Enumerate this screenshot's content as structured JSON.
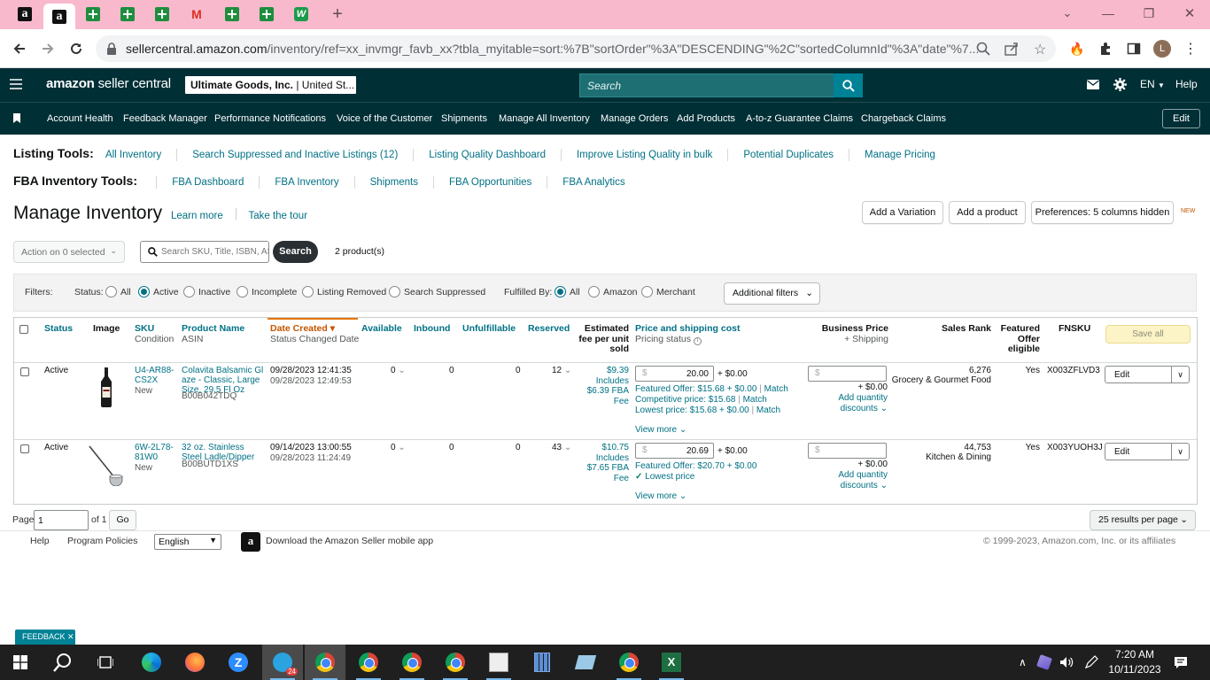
{
  "browser": {
    "url_host": "sellercentral.amazon.com",
    "url_path": "/inventory/ref=xx_invmgr_favb_xx?tbla_myitable=sort:%7B\"sortOrder\"%3A\"DESCENDING\"%2C\"sortedColumnId\"%3A\"date\"%7...",
    "profile_initial": "L",
    "tab_amazon_a": "a",
    "window_controls": {
      "chevron": "⌄",
      "minimize": "—",
      "restore": "❐",
      "close": "✕"
    }
  },
  "header": {
    "logo_amazon": "amazon",
    "logo_rest": " seller central",
    "account_bold": "Ultimate Goods, Inc.",
    "account_rest": " | United St...",
    "search_placeholder": "Search",
    "lang": "EN",
    "help": "Help"
  },
  "menu": {
    "items": [
      "Account Health",
      "Feedback Manager",
      "Performance Notifications",
      "Voice of the Customer",
      "Shipments",
      "Manage All Inventory",
      "Manage Orders",
      "Add Products",
      "A-to-z Guarantee Claims",
      "Chargeback Claims"
    ],
    "edit": "Edit"
  },
  "listing_tools": {
    "label": "Listing Tools:",
    "links": [
      "All Inventory",
      "Search Suppressed and Inactive Listings (12)",
      "Listing Quality Dashboard",
      "Improve Listing Quality in bulk",
      "Potential Duplicates",
      "Manage Pricing"
    ]
  },
  "fba_tools": {
    "label": "FBA Inventory Tools:",
    "links": [
      "FBA Dashboard",
      "FBA Inventory",
      "Shipments",
      "FBA Opportunities",
      "FBA Analytics"
    ]
  },
  "page": {
    "title": "Manage Inventory",
    "learn_more": "Learn more",
    "take_tour": "Take the tour",
    "add_variation": "Add a Variation",
    "add_product": "Add a product",
    "preferences": "Preferences: 5 columns hidden",
    "new_badge": "NEW"
  },
  "search": {
    "action_select": "Action on 0 selected",
    "placeholder": "Search SKU, Title, ISBN, ASIN",
    "button": "Search",
    "count": "2 product(s)"
  },
  "filters": {
    "label": "Filters:",
    "status_label": "Status:",
    "status_options": [
      "All",
      "Active",
      "Inactive",
      "Incomplete",
      "Listing Removed",
      "Search Suppressed"
    ],
    "status_selected": "Active",
    "fulfilled_label": "Fulfilled By:",
    "fulfilled_options": [
      "All",
      "Amazon",
      "Merchant"
    ],
    "fulfilled_selected": "All",
    "additional": "Additional filters"
  },
  "table": {
    "headers": {
      "status": "Status",
      "image": "Image",
      "sku": "SKU",
      "sku_sub": "Condition",
      "product_name": "Product Name",
      "product_sub": "ASIN",
      "date_created": "Date Created",
      "date_sub": "Status Changed Date",
      "available": "Available",
      "inbound": "Inbound",
      "unfulfillable": "Unfulfillable",
      "reserved": "Reserved",
      "fee_l1": "Estimated",
      "fee_l2": "fee per unit",
      "fee_l3": "sold",
      "price": "Price and shipping cost",
      "price_sub": "Pricing status",
      "business_price": "Business Price",
      "business_sub": "+ Shipping",
      "sales_rank": "Sales Rank",
      "featured_l1": "Featured",
      "featured_l2": "Offer",
      "featured_l3": "eligible",
      "fnsku": "FNSKU",
      "save_all": "Save all"
    },
    "rows": [
      {
        "status": "Active",
        "sku": "U4-AR88-CS2X",
        "condition": "New",
        "name": "Colavita Balsamic Glaze - Classic, Large Size, 29.5 Fl Oz",
        "asin": "B00B042TDQ",
        "created": "09/28/2023 12:41:35",
        "changed": "09/28/2023 12:49:53",
        "available": "0",
        "inbound": "0",
        "unfulfillable": "0",
        "reserved": "12",
        "fee": "$9.39",
        "fee_inc": "Includes",
        "fee_fba": "$6.39 FBA",
        "fee_word": "Fee",
        "currency": "$",
        "price": "20.00",
        "shipping": "+ $0.00",
        "line1": "Featured Offer: $15.68 + $0.00",
        "line1_link": "Match",
        "line2": "Competitive price: $15.68",
        "line2_link": "Match",
        "line3": "Lowest price: $15.68 + $0.00",
        "line3_link": "Match",
        "view_more": "View more",
        "bp_ship": "+ $0.00",
        "bp_add": "Add quantity",
        "bp_disc": "discounts",
        "rank": "6,276",
        "rank_cat": "Grocery & Gourmet Food",
        "featured": "Yes",
        "fnsku": "X003ZFLVD3",
        "edit": "Edit"
      },
      {
        "status": "Active",
        "sku": "6W-2L78-81W0",
        "condition": "New",
        "name": "32 oz. Stainless Steel Ladle/Dipper",
        "asin": "B00BUTD1XS",
        "created": "09/14/2023 13:00:55",
        "changed": "09/28/2023 11:24:49",
        "available": "0",
        "inbound": "0",
        "unfulfillable": "0",
        "reserved": "43",
        "fee": "$10.75",
        "fee_inc": "Includes",
        "fee_fba": "$7.65 FBA",
        "fee_word": "Fee",
        "currency": "$",
        "price": "20.69",
        "shipping": "+ $0.00",
        "line1": "Featured Offer: $20.70 + $0.00",
        "lowest": "Lowest price",
        "view_more": "View more",
        "bp_ship": "+ $0.00",
        "bp_add": "Add quantity",
        "bp_disc": "discounts",
        "rank": "44,753",
        "rank_cat": "Kitchen & Dining",
        "featured": "Yes",
        "fnsku": "X003YUOH3J",
        "edit": "Edit"
      }
    ]
  },
  "pager": {
    "page_label": "Page",
    "page_value": "1",
    "of": "of 1",
    "go": "Go",
    "per_page": "25 results per page"
  },
  "footer": {
    "help": "Help",
    "policies": "Program Policies",
    "language": "English",
    "app": "Download the Amazon Seller mobile app",
    "copyright": "© 1999-2023, Amazon.com, Inc. or its affiliates",
    "feedback": "FEEDBACK ✕"
  },
  "taskbar": {
    "time": "7:20 AM",
    "date": "10/11/2023",
    "badge": "24",
    "zoom_letter": "Z",
    "excel_letter": "X"
  },
  "colors": {
    "header_bg": "#002f36",
    "link": "#007185",
    "tabstrip": "#f9b9cd"
  }
}
